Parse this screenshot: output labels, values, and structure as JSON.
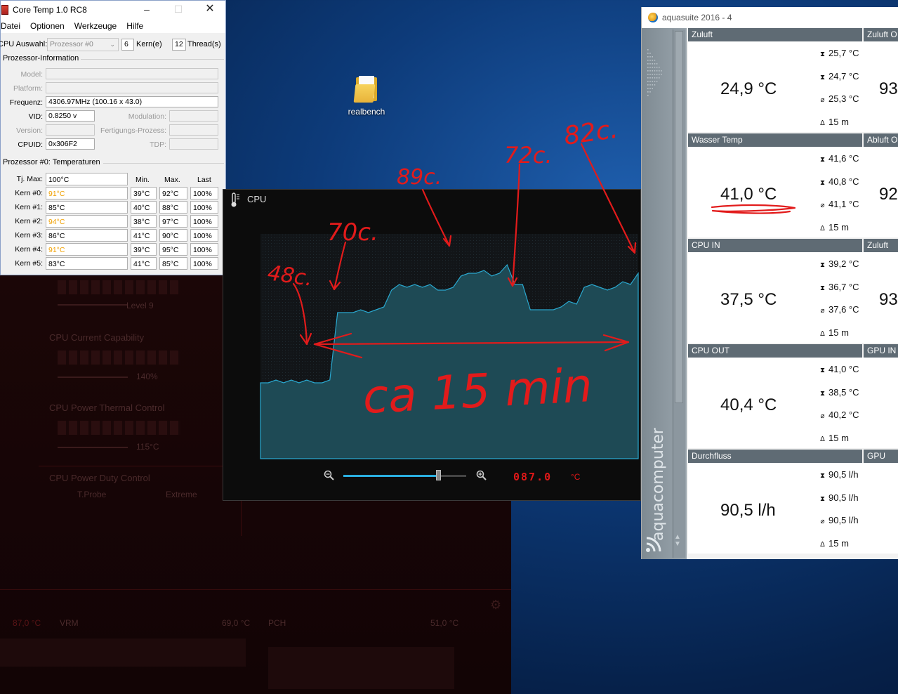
{
  "coretemp": {
    "title": "Core Temp 1.0 RC8",
    "menu": [
      "Datei",
      "Optionen",
      "Werkzeuge",
      "Hilfe"
    ],
    "cpu_select_label": "CPU Auswahl:",
    "cpu_select_value": "Prozessor #0",
    "cores_value": "6",
    "cores_label": "Kern(e)",
    "threads_value": "12",
    "threads_label": "Thread(s)",
    "info_group": "Prozessor-Information",
    "model_label": "Model:",
    "model_value": "",
    "platform_label": "Platform:",
    "platform_value": "",
    "freq_label": "Frequenz:",
    "freq_value": "4306.97MHz (100.16 x 43.0)",
    "vid_label": "VID:",
    "vid_value": "0.8250 v",
    "modulation_label": "Modulation:",
    "version_label": "Version:",
    "process_label": "Fertigungs-Prozess:",
    "cpuid_label": "CPUID:",
    "cpuid_value": "0x306F2",
    "tdp_label": "TDP:",
    "temps_group": "Prozessor #0: Temperaturen",
    "tjmax_label": "Tj. Max:",
    "tjmax_value": "100°C",
    "col_min": "Min.",
    "col_max": "Max.",
    "col_last": "Last",
    "cores": [
      {
        "label": "Kern #0:",
        "temp": "91°C",
        "min": "39°C",
        "max": "92°C",
        "load": "100%",
        "hot": true
      },
      {
        "label": "Kern #1:",
        "temp": "85°C",
        "min": "40°C",
        "max": "88°C",
        "load": "100%",
        "hot": false
      },
      {
        "label": "Kern #2:",
        "temp": "94°C",
        "min": "38°C",
        "max": "97°C",
        "load": "100%",
        "hot": true
      },
      {
        "label": "Kern #3:",
        "temp": "86°C",
        "min": "41°C",
        "max": "90°C",
        "load": "100%",
        "hot": false
      },
      {
        "label": "Kern #4:",
        "temp": "91°C",
        "min": "39°C",
        "max": "95°C",
        "load": "100%",
        "hot": true
      },
      {
        "label": "Kern #5:",
        "temp": "83°C",
        "min": "41°C",
        "max": "85°C",
        "load": "100%",
        "hot": false
      }
    ],
    "hot_color": "#f0a000"
  },
  "desktop": {
    "icon_label": "realbench"
  },
  "background_app": {
    "level_label": "Level 9",
    "current_cap": "CPU Current Capability",
    "current_cap_value": "140%",
    "thermal_ctrl": "CPU Power Thermal Control",
    "thermal_value": "115°C",
    "duty_ctrl": "CPU Power Duty Control",
    "tprobe": "T.Probe",
    "extreme": "Extreme",
    "cpu_temp": "87,0 °C",
    "vrm": "VRM",
    "vrm_temp": "69,0 °C",
    "pch": "PCH",
    "pch_temp": "51,0 °C"
  },
  "cpu_window": {
    "title": "CPU",
    "readout": "087.0",
    "unit": "°C",
    "zoom_position": 0.77,
    "accent": "#2ab0e0"
  },
  "chart_data": {
    "type": "area",
    "title": "CPU",
    "xlabel": "",
    "ylabel": "",
    "series": [
      {
        "values": [
          47,
          47,
          48,
          47,
          48,
          47,
          48,
          47,
          47,
          48,
          72,
          72,
          72,
          73,
          72,
          73,
          74,
          80,
          82,
          81,
          82,
          81,
          82,
          80,
          80,
          81,
          85,
          86,
          86,
          87,
          85,
          86,
          89,
          82,
          82,
          73,
          73,
          73,
          73,
          74,
          76,
          75,
          81,
          82,
          81,
          80,
          81,
          83,
          82,
          86
        ]
      }
    ],
    "x_range_minutes": 15
  },
  "annotations": {
    "texts": [
      "48c.",
      "70c.",
      "89c.",
      "72c.",
      "82c.",
      "ca 15 min"
    ],
    "color": "#e21b1b"
  },
  "aquasuite": {
    "title": "aquasuite 2016 - 4",
    "brand": "aquacomputer",
    "tiles": [
      {
        "name": "Zuluft",
        "value": "24,9 °C",
        "max": "25,7 °C",
        "min": "24,7 °C",
        "avg": "25,3 °C",
        "period": "15 m",
        "right_name": "Zuluft O",
        "right_partial": "93"
      },
      {
        "name": "Wasser Temp",
        "value": "41,0 °C",
        "max": "41,6 °C",
        "min": "40,8 °C",
        "avg": "41,1 °C",
        "period": "15 m",
        "right_name": "Abluft O",
        "right_partial": "92"
      },
      {
        "name": "CPU IN",
        "value": "37,5 °C",
        "max": "39,2 °C",
        "min": "36,7 °C",
        "avg": "37,6 °C",
        "period": "15 m",
        "right_name": "Zuluft Vo",
        "right_partial": "93"
      },
      {
        "name": "CPU OUT",
        "value": "40,4 °C",
        "max": "41,0 °C",
        "min": "38,5 °C",
        "avg": "40,2 °C",
        "period": "15 m",
        "right_name": "GPU IN",
        "right_partial": ""
      },
      {
        "name": "Durchfluss",
        "value": "90,5 l/h",
        "max": "90,5 l/h",
        "min": "90,5 l/h",
        "avg": "90,5 l/h",
        "period": "15 m",
        "right_name": "GPU OUT",
        "right_partial": ""
      }
    ]
  }
}
